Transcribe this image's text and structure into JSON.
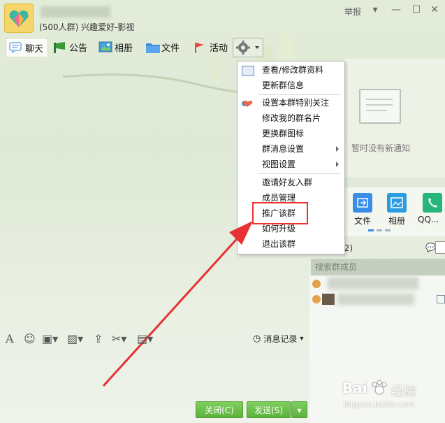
{
  "header": {
    "group_desc": "(500人群) 兴趣爱好-影视",
    "report_label": "举报"
  },
  "toolbar": {
    "chat": "聊天",
    "notice": "公告",
    "album": "相册",
    "file": "文件",
    "activity": "活动"
  },
  "menu": {
    "items": [
      "查看/修改群资料",
      "更新群信息",
      "设置本群特别关注",
      "修改我的群名片",
      "更换群图标",
      "群消息设置",
      "视图设置",
      "邀请好友入群",
      "成员管理",
      "推广该群",
      "如何升级",
      "退出该群"
    ]
  },
  "right": {
    "no_notice": "暂时没有新通知",
    "apps": [
      "文件",
      "相册",
      "QQ..."
    ],
    "members_count": "1/2)",
    "search_placeholder": "搜索群成员"
  },
  "input": {
    "msg_record": "消息记录"
  },
  "buttons": {
    "close": "关闭(C)",
    "send": "发送(S)"
  },
  "watermark": {
    "brand": "Bai",
    "brand2": "经验",
    "url": "jingyan.baidu.com"
  },
  "colors": {
    "accent_green": "#5db23c",
    "highlight_red": "#e33333"
  }
}
